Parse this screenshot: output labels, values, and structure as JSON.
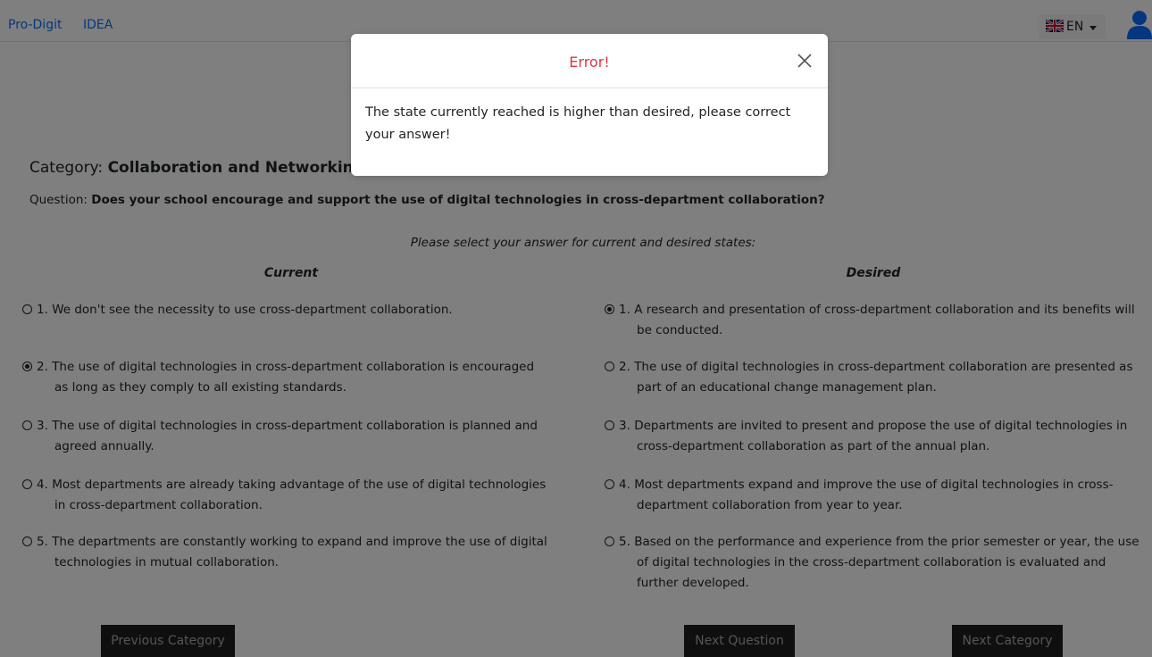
{
  "nav": {
    "brand": "Pro-Digit",
    "link": "IDEA",
    "lang": "EN"
  },
  "category_label": "Category:",
  "category_value": "Collaboration and Networking",
  "question_label": "Question:",
  "question_text": "Does your school encourage and support the use of digital technologies in cross-department collaboration?",
  "prompt": "Please select your answer for current and desired states:",
  "current": {
    "heading": "Current",
    "options": [
      {
        "num": "1.",
        "text": "We don't see the necessity to use cross-department collaboration.",
        "checked": false
      },
      {
        "num": "2.",
        "text": "The use of digital technologies in cross-department collaboration is encouraged as long as they comply to all existing standards.",
        "checked": true
      },
      {
        "num": "3.",
        "text": "The use of digital technologies in cross-department collaboration is planned and agreed annually.",
        "checked": false
      },
      {
        "num": "4.",
        "text": "Most departments are already taking advantage of the use of digital technologies in cross-department collaboration.",
        "checked": false
      },
      {
        "num": "5.",
        "text": "The departments are constantly working to expand and improve the use of digital technologies in mutual collaboration.",
        "checked": false
      }
    ]
  },
  "desired": {
    "heading": "Desired",
    "options": [
      {
        "num": "1.",
        "text": "A research and presentation of cross-department collaboration and its benefits will be conducted.",
        "checked": true
      },
      {
        "num": "2.",
        "text": "The use of digital technologies in cross-department collaboration are presented as part of an educational change management plan.",
        "checked": false
      },
      {
        "num": "3.",
        "text": "Departments are invited to present and propose the use of digital technologies in cross-department collaboration as part of the annual plan.",
        "checked": false
      },
      {
        "num": "4.",
        "text": "Most departments expand and improve the use of digital technologies in cross-department collaboration from year to year.",
        "checked": false
      },
      {
        "num": "5.",
        "text": "Based on the performance and experience from the prior semester or year, the use of digital technologies in the cross-department collaboration is evaluated and further developed.",
        "checked": false
      }
    ]
  },
  "buttons": {
    "previous_category": "Previous Category",
    "next_question": "Next Question",
    "next_category": "Next Category"
  },
  "modal": {
    "title": "Error!",
    "message": "The state currently reached is higher than desired, please correct your answer!"
  },
  "colors": {
    "link": "#0d6efd",
    "error_title": "#dc3545",
    "overlay": "rgba(0,0,0,0.5)"
  },
  "icons": {
    "flag": "uk-flag-icon",
    "user": "user-icon",
    "close": "close-icon",
    "caret": "caret-down-icon"
  }
}
